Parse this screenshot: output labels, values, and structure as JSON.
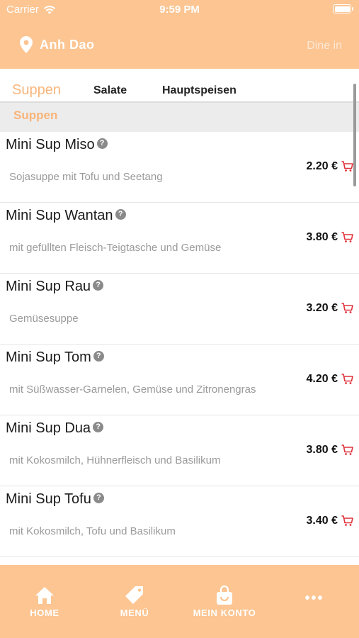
{
  "status_bar": {
    "carrier": "Carrier",
    "time": "9:59 PM"
  },
  "header": {
    "store_name": "Anh Dao",
    "mode": "Dine in"
  },
  "tabs": [
    {
      "label": "Suppen",
      "active": true
    },
    {
      "label": "Salate",
      "active": false
    },
    {
      "label": "Hauptspeisen",
      "active": false
    }
  ],
  "section": {
    "label": "Suppen"
  },
  "items": [
    {
      "name": "Mini Sup Miso",
      "description": "Sojasuppe mit Tofu und Seetang",
      "price": "2.20 €"
    },
    {
      "name": "Mini Sup Wantan",
      "description": "mit gefüllten Fleisch-Teigtasche und Gemüse",
      "price": "3.80 €"
    },
    {
      "name": "Mini Sup Rau",
      "description": "Gemüsesuppe",
      "price": "3.20 €"
    },
    {
      "name": "Mini Sup Tom",
      "description": "mit Süßwasser-Garnelen, Gemüse und Zitronengras",
      "price": "4.20 €"
    },
    {
      "name": "Mini Sup Dua",
      "description": "mit Kokosmilch, Hühnerfleisch und Basilikum",
      "price": "3.80 €"
    },
    {
      "name": "Mini Sup Tofu",
      "description": "mit Kokosmilch, Tofu und Basilikum",
      "price": "3.40 €"
    }
  ],
  "tabbar": {
    "home": "HOME",
    "menu": "MENÜ",
    "account": "MEIN KONTO",
    "more": "•••"
  },
  "colors": {
    "accent": "#fcc592",
    "active_tab": "#f9b57a",
    "cart": "#e0303a"
  }
}
